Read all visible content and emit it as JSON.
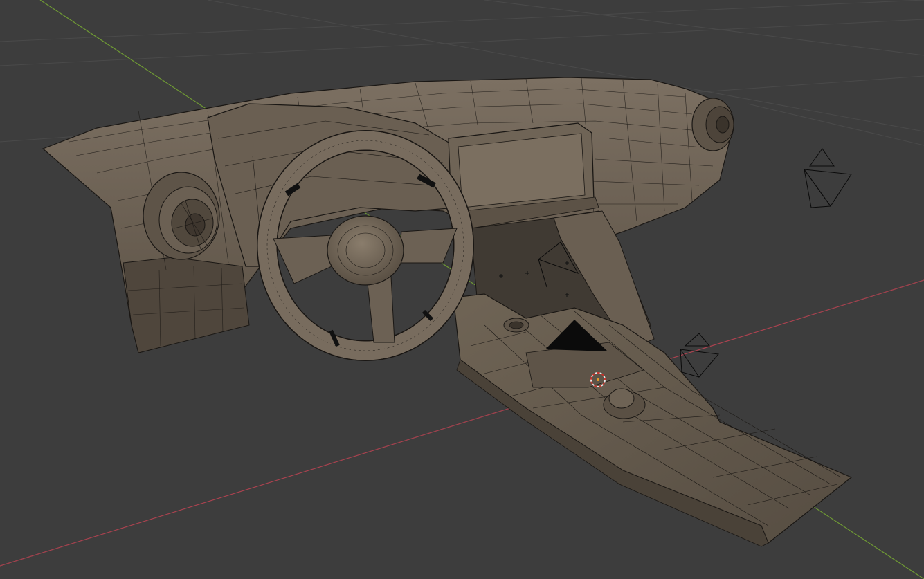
{
  "app": {
    "name": "3D viewport",
    "view": "perspective",
    "shading": "solid-wireframe",
    "overlay_text": ""
  },
  "scene": {
    "objects": [
      {
        "name": "dashboard",
        "icon": "mesh-icon"
      },
      {
        "name": "steering-wheel",
        "icon": "mesh-icon"
      },
      {
        "name": "infotainment-screen",
        "icon": "mesh-icon"
      },
      {
        "name": "center-console",
        "icon": "mesh-icon"
      },
      {
        "name": "left-air-vent",
        "icon": "mesh-icon"
      },
      {
        "name": "right-air-vent",
        "icon": "mesh-icon"
      }
    ],
    "cameras": 3,
    "lights": 1,
    "has_3d_cursor": true
  },
  "colors": {
    "background": "#3d3d3d",
    "grid": "#4a4a4a",
    "x_axis": "#a8424f",
    "y_axis": "#6f9a34",
    "mesh_fill": "#6e6355",
    "mesh_shadow": "#4f463c",
    "wire": "#1a1714",
    "camera_wire": "#0a0a0a"
  }
}
